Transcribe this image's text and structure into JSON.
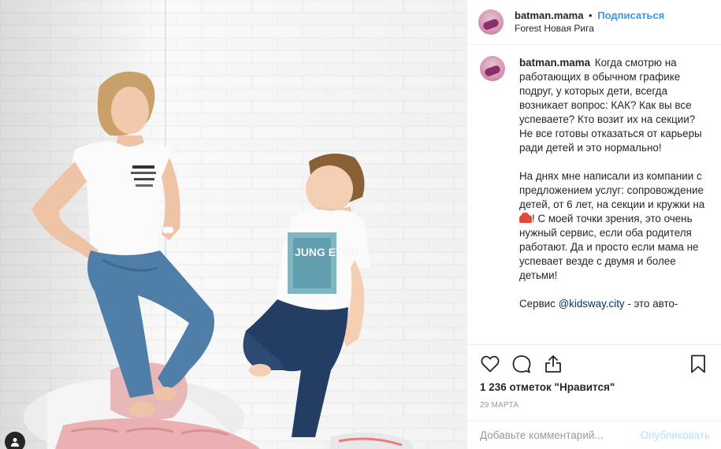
{
  "photo": {
    "alt_icon": "user-tag-icon",
    "shirt_text": "JUNG ETRO"
  },
  "header": {
    "username": "batman.mama",
    "separator": "•",
    "follow_label": "Подписаться",
    "location": "Forest Новая Рига"
  },
  "caption": {
    "username": "batman.mama",
    "p1": "Когда смотрю на работающих в обычном графике подруг, у которых дети, всегда возникает вопрос: КАК? Как вы все успеваете? Кто возит их на секции? Не все готовы отказаться от карьеры ради детей и это нормально!",
    "p2_before": "На днях мне написали из компании с предложением услуг: сопровождение детей, от 6 лет, на секции и кружки на ",
    "p2_after": "! С моей точки зрения, это очень нужный сервис, если оба родителя работают. Да и просто если мама не успевает везде с двумя и более детьми!",
    "p3_before": "Сервис ",
    "mention": "@kidsway.city",
    "p3_after": " - это авто-"
  },
  "actions": {
    "icons": [
      "heart-icon",
      "comment-icon",
      "share-icon",
      "bookmark-icon"
    ]
  },
  "likes": "1 236 отметок \"Нравится\"",
  "date": "29 марта",
  "comment": {
    "placeholder": "Добавьте комментарий...",
    "publish_label": "Опубликовать"
  },
  "colors": {
    "accent": "#3897f0",
    "mention": "#003569",
    "muted": "#999999",
    "publish_disabled": "#b2dffc"
  }
}
